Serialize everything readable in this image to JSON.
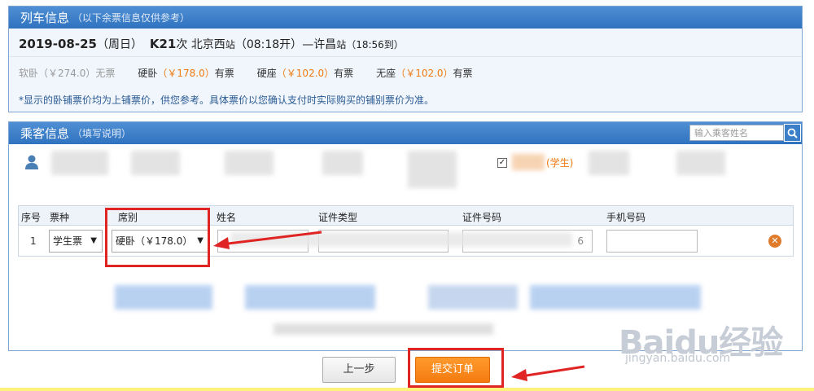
{
  "train_panel": {
    "title": "列车信息",
    "subtitle": "（以下余票信息仅供参考）",
    "date": "2019-08-25",
    "weekday": "（周日）",
    "train_no": "K21",
    "train_suffix": "次",
    "from_station": "北京西",
    "from_suffix": "站",
    "depart": "（08:18开）",
    "dash": "—",
    "to_station": "许昌",
    "to_suffix": "站",
    "arrive": "（18:56到）",
    "prices": [
      {
        "name": "软卧",
        "price": "（￥274.0）",
        "status": "无票",
        "available": false
      },
      {
        "name": "硬卧",
        "price": "（￥178.0）",
        "status": "有票",
        "available": true
      },
      {
        "name": "硬座",
        "price": "（￥102.0）",
        "status": "有票",
        "available": true
      },
      {
        "name": "无座",
        "price": "（￥102.0）",
        "status": "有票",
        "available": true
      }
    ],
    "note": "*显示的卧铺票价均为上铺票价，供您参考。具体票价以您确认支付时实际购买的铺别票价为准。"
  },
  "passenger_panel": {
    "title": "乘客信息",
    "subtitle": "（填写说明）",
    "search_placeholder": "输入乘客姓名",
    "student_tag": "(学生)",
    "columns": [
      "序号",
      "票种",
      "席别",
      "姓名",
      "证件类型",
      "证件号码",
      "手机号码"
    ],
    "row": {
      "num": "1",
      "ticket_type": "学生票",
      "seat_type": "硬卧（￥178.0）",
      "id_number_tail": "6"
    }
  },
  "buttons": {
    "prev": "上一步",
    "submit": "提交订单"
  },
  "watermark": {
    "logo": "Baidu经验",
    "url": "jingyan.baidu.com"
  },
  "colors": {
    "header_blue": "#2f72bf",
    "accent_orange": "#f47b0f",
    "highlight_red": "#e02424"
  }
}
